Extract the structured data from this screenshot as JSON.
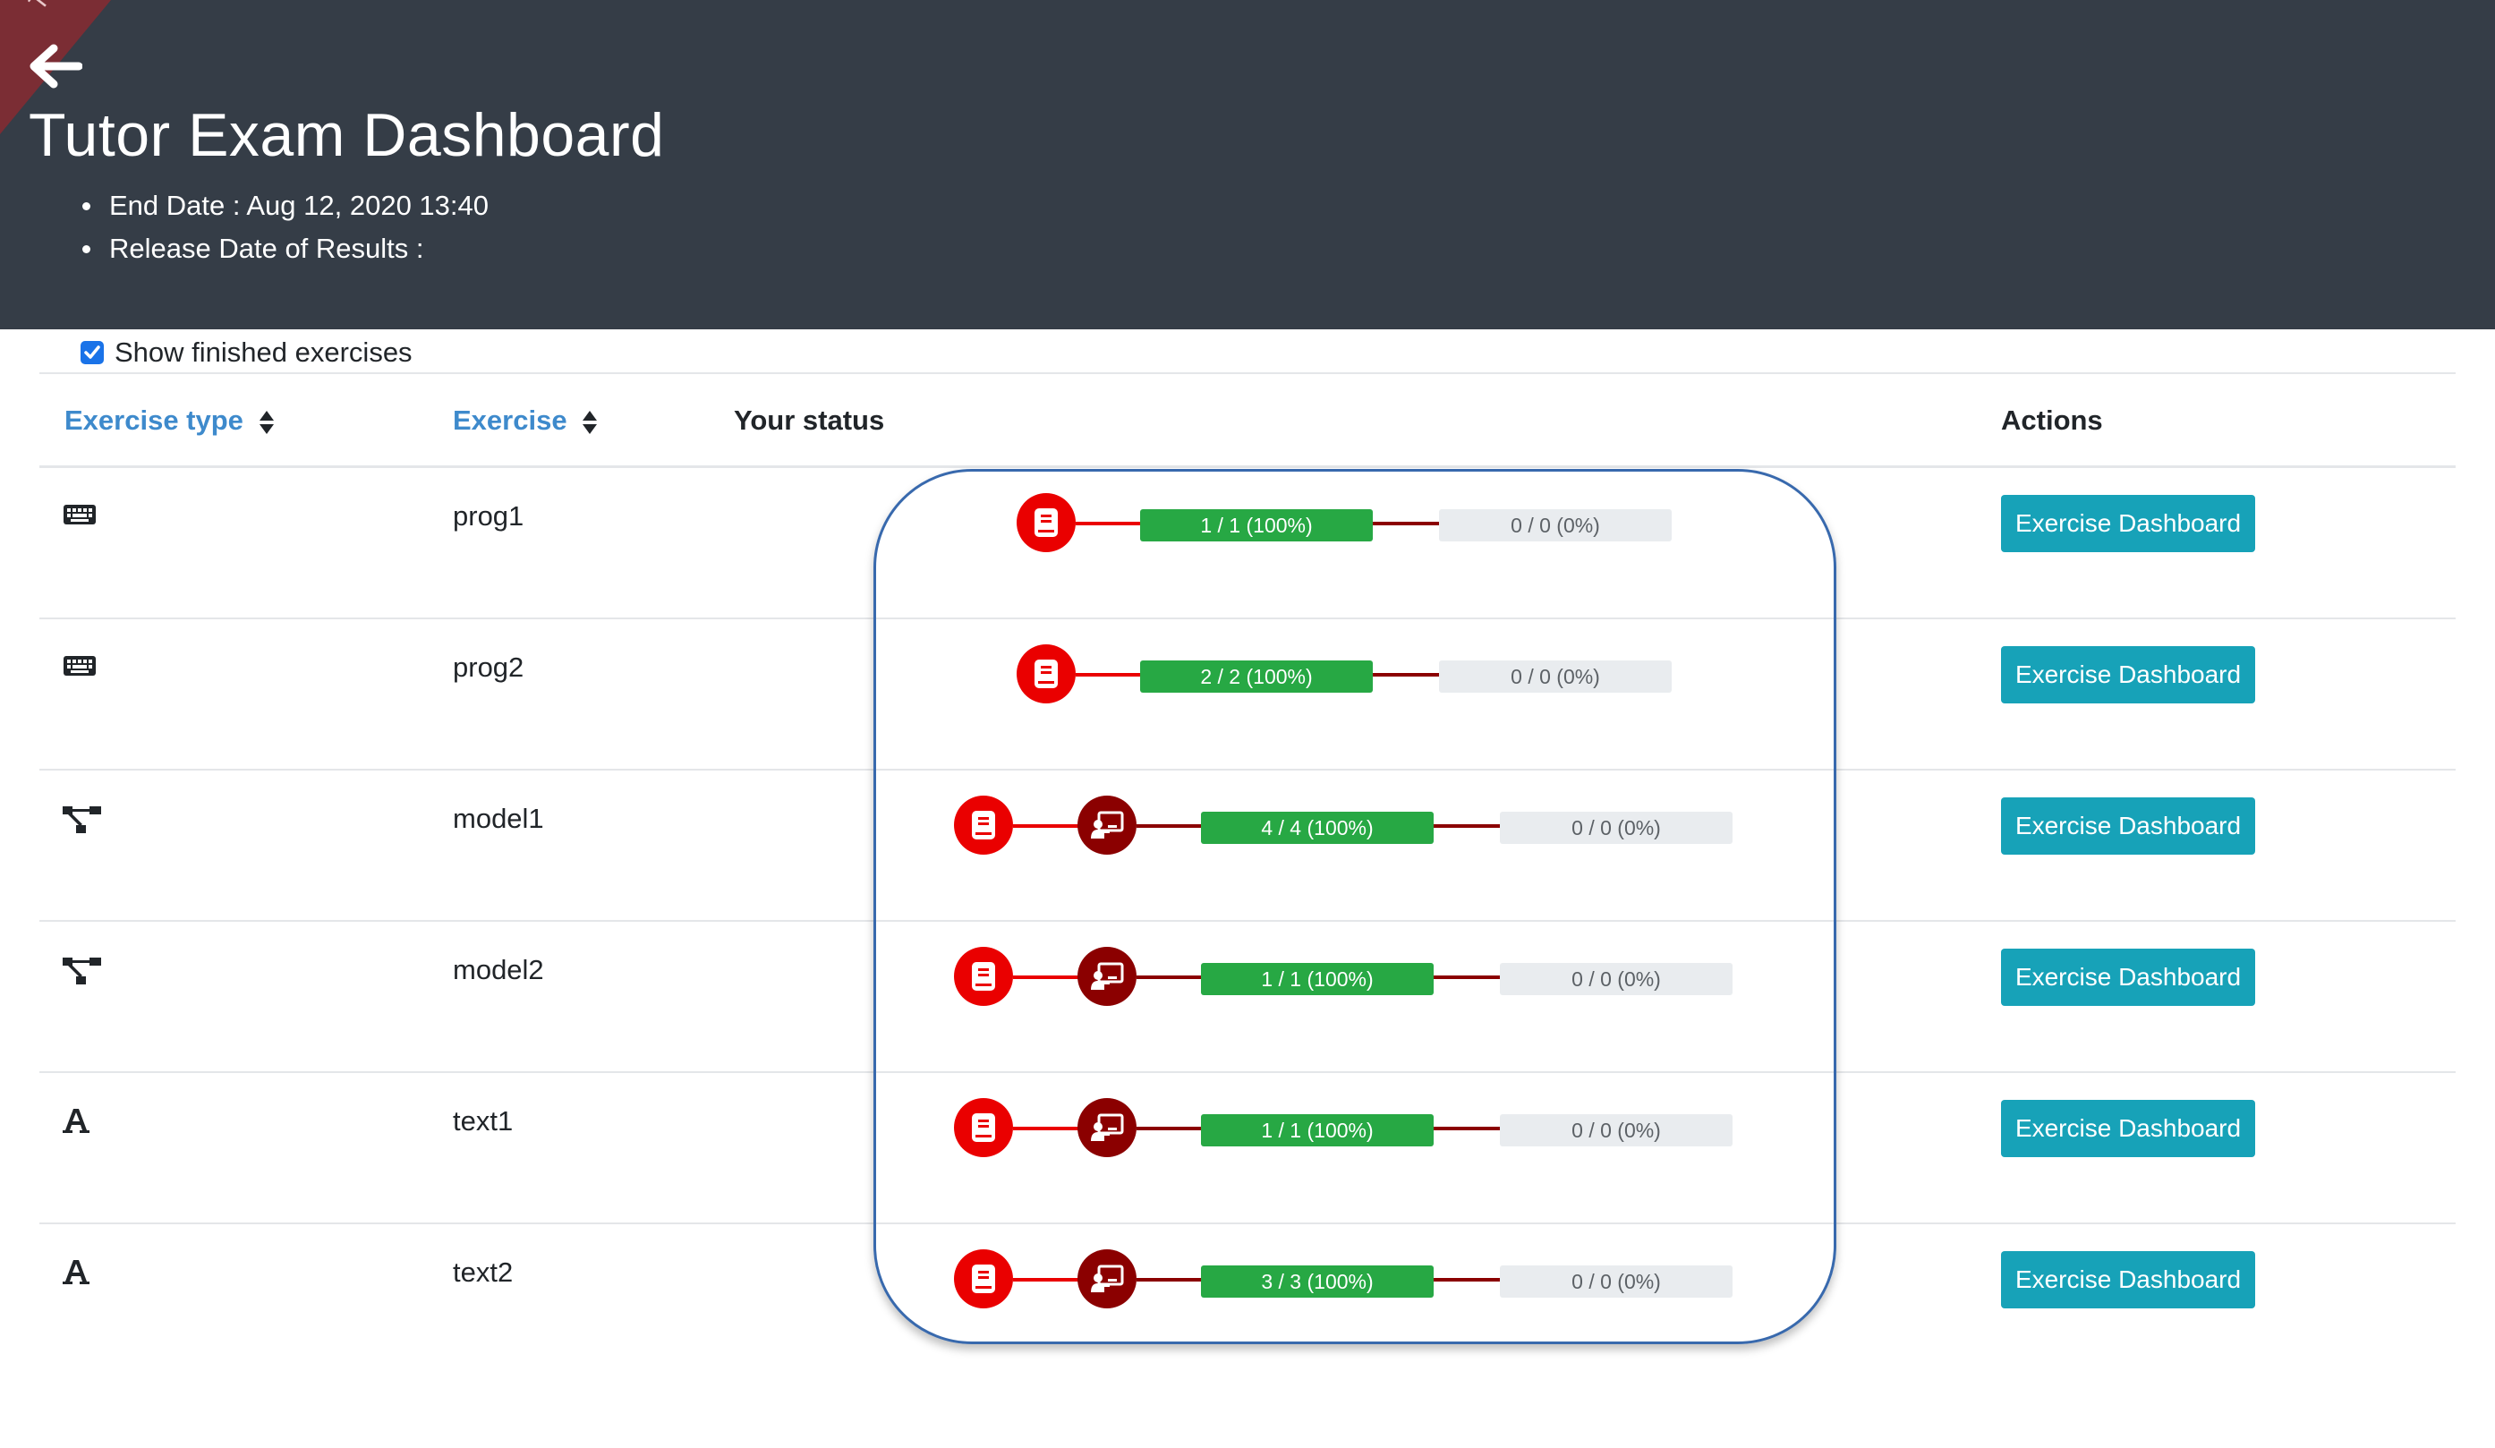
{
  "header": {
    "ribbon_text": "Te",
    "title": "Tutor Exam Dashboard",
    "end_date": "End Date : Aug 12, 2020 13:40",
    "release_date": "Release Date of Results :"
  },
  "filter": {
    "show_finished_label": "Show finished exercises",
    "show_finished_checked": true
  },
  "table": {
    "columns": {
      "exercise_type": "Exercise type",
      "exercise": "Exercise",
      "your_status": "Your status",
      "actions": "Actions"
    },
    "rows": [
      {
        "type_icon": "keyboard-icon",
        "name": "prog1",
        "steps": [
          "book-icon"
        ],
        "assessed": "1 / 1 (100%)",
        "complaints": "0 / 0 (0%)",
        "action": "Exercise Dashboard"
      },
      {
        "type_icon": "keyboard-icon",
        "name": "prog2",
        "steps": [
          "book-icon"
        ],
        "assessed": "2 / 2 (100%)",
        "complaints": "0 / 0 (0%)",
        "action": "Exercise Dashboard"
      },
      {
        "type_icon": "project-diagram-icon",
        "name": "model1",
        "steps": [
          "book-icon",
          "teacher-icon"
        ],
        "assessed": "4 / 4 (100%)",
        "complaints": "0 / 0 (0%)",
        "action": "Exercise Dashboard"
      },
      {
        "type_icon": "project-diagram-icon",
        "name": "model2",
        "steps": [
          "book-icon",
          "teacher-icon"
        ],
        "assessed": "1 / 1 (100%)",
        "complaints": "0 / 0 (0%)",
        "action": "Exercise Dashboard"
      },
      {
        "type_icon": "font-icon",
        "name": "text1",
        "steps": [
          "book-icon",
          "teacher-icon"
        ],
        "assessed": "1 / 1 (100%)",
        "complaints": "0 / 0 (0%)",
        "action": "Exercise Dashboard"
      },
      {
        "type_icon": "font-icon",
        "name": "text2",
        "steps": [
          "book-icon",
          "teacher-icon"
        ],
        "assessed": "3 / 3 (100%)",
        "complaints": "0 / 0 (0%)",
        "action": "Exercise Dashboard"
      }
    ]
  },
  "colors": {
    "header_bg": "#353d47",
    "link_blue": "#3e8acc",
    "step_red": "#ea0000",
    "step_dark_red": "#8b0000",
    "progress_green": "#27a844",
    "button_teal": "#17a2b8",
    "highlight_border": "#3869ad"
  }
}
